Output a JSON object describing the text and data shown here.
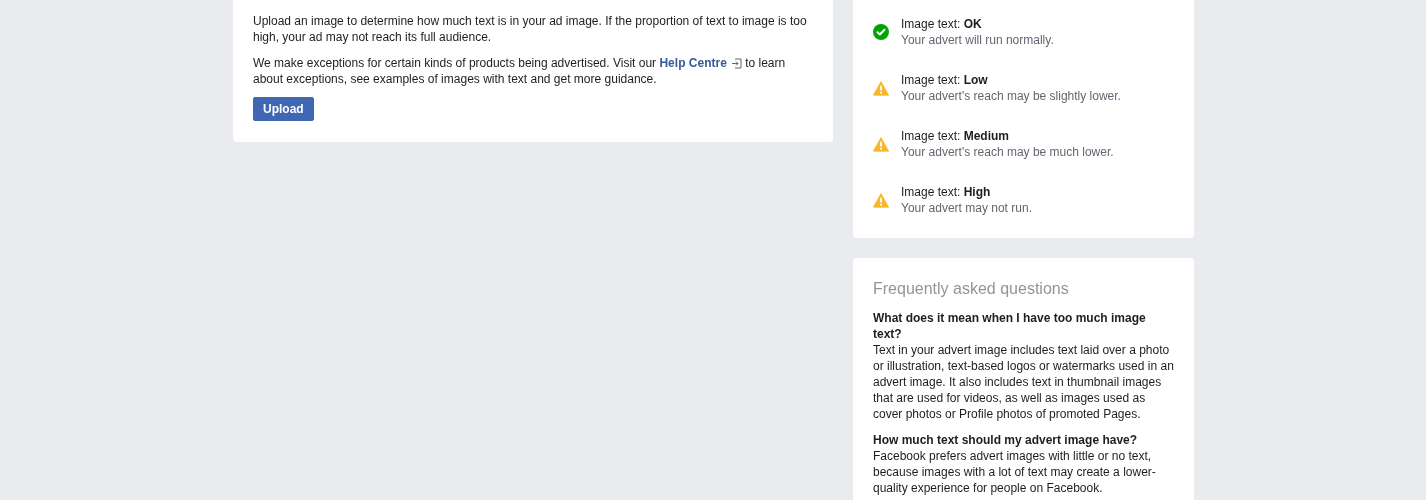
{
  "intro_card": {
    "paragraph_1": "Upload an image to determine how much text is in your ad image. If the proportion of text to image is too high, your ad may not reach its full audience.",
    "paragraph_2": {
      "before": "We make exceptions for certain kinds of products being advertised. Visit our",
      "link": "Help Centre",
      "after": "to learn about exceptions, see examples of images with text and get more guidance."
    },
    "upload_button": "Upload"
  },
  "ratings": [
    {
      "kind": "ok",
      "label": "Image text: **OK**",
      "description": "Your advert will run normally."
    },
    {
      "kind": "warning",
      "label": "Image text: **Low**",
      "description": "Your advert's reach may be slightly lower."
    },
    {
      "kind": "warning",
      "label": "Image text: **Medium**",
      "description": "Your advert's reach may be much lower."
    },
    {
      "kind": "warning",
      "label": "Image text: **High**",
      "description": "Your advert may not run."
    }
  ],
  "faq": {
    "title": "Frequently asked questions",
    "items": [
      {
        "question": "What does it mean when I have too much image text?",
        "answer": "Text in your advert image includes text laid over a photo or illustration, text-based logos or watermarks used in an advert image. It also includes text in thumbnail images that are used for videos, as well as images used as cover photos or Profile photos of promoted Pages."
      },
      {
        "question": "How much text should my advert image have?",
        "answer": "Facebook prefers advert images with little or no text, because images with a lot of text may create a lower-quality experience for people on Facebook."
      }
    ]
  }
}
